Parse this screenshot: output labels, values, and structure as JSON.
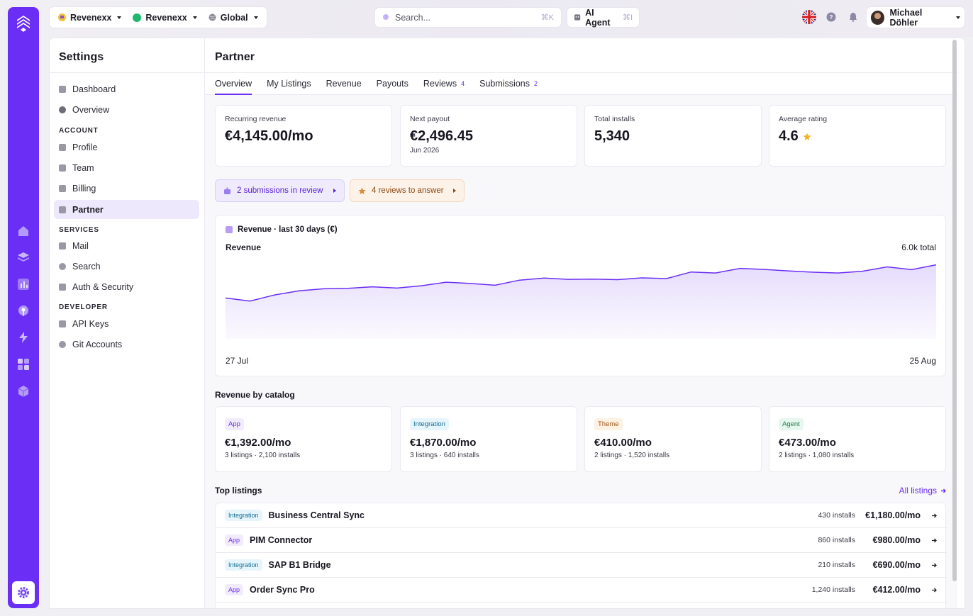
{
  "topbar": {
    "orgs": [
      {
        "label": "Revenexx",
        "icon": "company-icon"
      },
      {
        "label": "Revenexx",
        "icon": "workspace-icon"
      },
      {
        "label": "Global",
        "icon": "globe-icon"
      }
    ],
    "search_placeholder": "Search...",
    "search_shortcut": "⌘K",
    "agent_label": "AI Agent",
    "agent_shortcut": "⌘I",
    "user_name": "Michael Döhler"
  },
  "sidebar": {
    "title": "Settings",
    "top_items": [
      {
        "label": "Dashboard",
        "icon": "dashboard-icon"
      },
      {
        "label": "Overview",
        "icon": "overview-icon"
      }
    ],
    "sections": [
      {
        "label": "ACCOUNT",
        "items": [
          {
            "label": "Profile",
            "icon": "user-icon"
          },
          {
            "label": "Team",
            "icon": "team-icon"
          },
          {
            "label": "Billing",
            "icon": "card-icon"
          },
          {
            "label": "Partner",
            "icon": "store-icon",
            "active": true
          }
        ]
      },
      {
        "label": "SERVICES",
        "items": [
          {
            "label": "Mail",
            "icon": "mail-icon"
          },
          {
            "label": "Search",
            "icon": "search-icon"
          },
          {
            "label": "Auth & Security",
            "icon": "shield-icon"
          }
        ]
      },
      {
        "label": "DEVELOPER",
        "items": [
          {
            "label": "API Keys",
            "icon": "key-icon"
          },
          {
            "label": "Git Accounts",
            "icon": "git-icon"
          }
        ]
      }
    ]
  },
  "page": {
    "title": "Partner",
    "tabs": [
      {
        "label": "Overview",
        "count": "",
        "active": true
      },
      {
        "label": "My Listings",
        "count": ""
      },
      {
        "label": "Revenue",
        "count": ""
      },
      {
        "label": "Payouts",
        "count": ""
      },
      {
        "label": "Reviews",
        "count": "4"
      },
      {
        "label": "Submissions",
        "count": "2"
      }
    ]
  },
  "kpis": [
    {
      "label": "Recurring revenue",
      "value": "€4,145.00/mo",
      "sub": ""
    },
    {
      "label": "Next payout",
      "value": "€2,496.45",
      "sub": "Jun 2026"
    },
    {
      "label": "Total installs",
      "value": "5,340",
      "sub": ""
    },
    {
      "label": "Average rating",
      "value": "4.6",
      "sub": "",
      "icon": "star-icon"
    }
  ],
  "alerts": {
    "submissions": "2 submissions in review",
    "reviews": "4 reviews to answer"
  },
  "revenue_chart": {
    "title": "Revenue · last 30 days (€)",
    "series_label": "Revenue",
    "total_label": "6.0k total",
    "x_start": "27 Jul",
    "x_end": "25 Aug",
    "line_color": "#6b2ef5",
    "fill_color": "#e4dafb"
  },
  "chart_data": {
    "type": "area",
    "x_start": "27 Jul",
    "x_end": "25 Aug",
    "values": [
      160,
      148,
      172,
      188,
      196,
      198,
      204,
      199,
      208,
      222,
      217,
      210,
      230,
      238,
      233,
      234,
      232,
      239,
      236,
      262,
      258,
      276,
      272,
      266,
      261,
      258,
      265,
      282,
      271,
      290
    ],
    "series": [
      {
        "name": "Revenue"
      }
    ],
    "total": "6.0k total",
    "grid": false
  },
  "catalog": {
    "title": "Revenue by catalog",
    "cards": [
      {
        "tag": "App",
        "kind": "app",
        "value": "€1,392.00/mo",
        "sub": "3 listings · 2,100 installs"
      },
      {
        "tag": "Integration",
        "kind": "integration",
        "value": "€1,870.00/mo",
        "sub": "3 listings · 640 installs"
      },
      {
        "tag": "Theme",
        "kind": "theme",
        "value": "€410.00/mo",
        "sub": "2 listings · 1,520 installs"
      },
      {
        "tag": "Agent",
        "kind": "agent",
        "value": "€473.00/mo",
        "sub": "2 listings · 1,080 installs"
      }
    ]
  },
  "top_listings": {
    "title": "Top listings",
    "all_link": "All listings",
    "rows": [
      {
        "tag": "Integration",
        "kind": "integration",
        "name": "Business Central Sync",
        "installs": "430 installs",
        "amount": "€1,180.00/mo"
      },
      {
        "tag": "App",
        "kind": "app",
        "name": "PIM Connector",
        "installs": "860 installs",
        "amount": "€980.00/mo"
      },
      {
        "tag": "Integration",
        "kind": "integration",
        "name": "SAP B1 Bridge",
        "installs": "210 installs",
        "amount": "€690.00/mo"
      },
      {
        "tag": "App",
        "kind": "app",
        "name": "Order Sync Pro",
        "installs": "1,240 installs",
        "amount": "€412.00/mo"
      }
    ]
  },
  "colors": {
    "brand": "#6b2ef5",
    "rail": "#6b2ef5"
  }
}
